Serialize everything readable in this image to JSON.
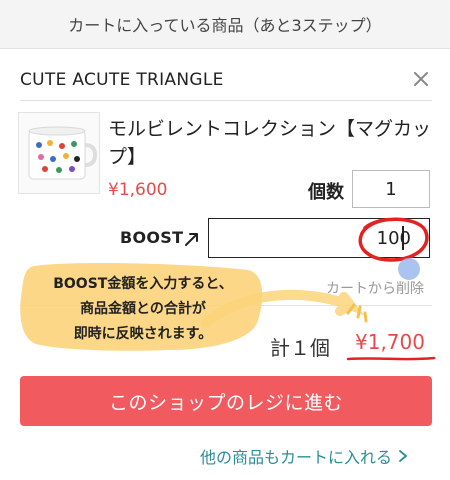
{
  "header": {
    "title": "カートに入っている商品（あと3ステップ）"
  },
  "shop": {
    "name": "CUTE ACUTE TRIANGLE",
    "close_icon": "close-icon"
  },
  "item": {
    "name": "モルビレントコレクション【マグカップ】",
    "price": "¥1,600",
    "qty_label": "個数",
    "qty_value": "1",
    "boost_label": "BOOST",
    "boost_icon": "arrow-up-right-icon",
    "boost_value": "100",
    "remove_label": "カートから削除"
  },
  "annotation": {
    "text_line1": "BOOST金額を入力すると、",
    "text_line2": "商品金額との合計が",
    "text_line3": "即時に反映されます。",
    "highlight_color": "#e52222",
    "bubble_color": "#fbd37a"
  },
  "summary": {
    "count_label": "計１個",
    "total": "¥1,700"
  },
  "actions": {
    "checkout_label": "このショップのレジに進む",
    "more_label": "他の商品もカートに入れる"
  },
  "colors": {
    "accent": "#f15a5f",
    "price": "#e84a4a",
    "link": "#2a8f96"
  }
}
